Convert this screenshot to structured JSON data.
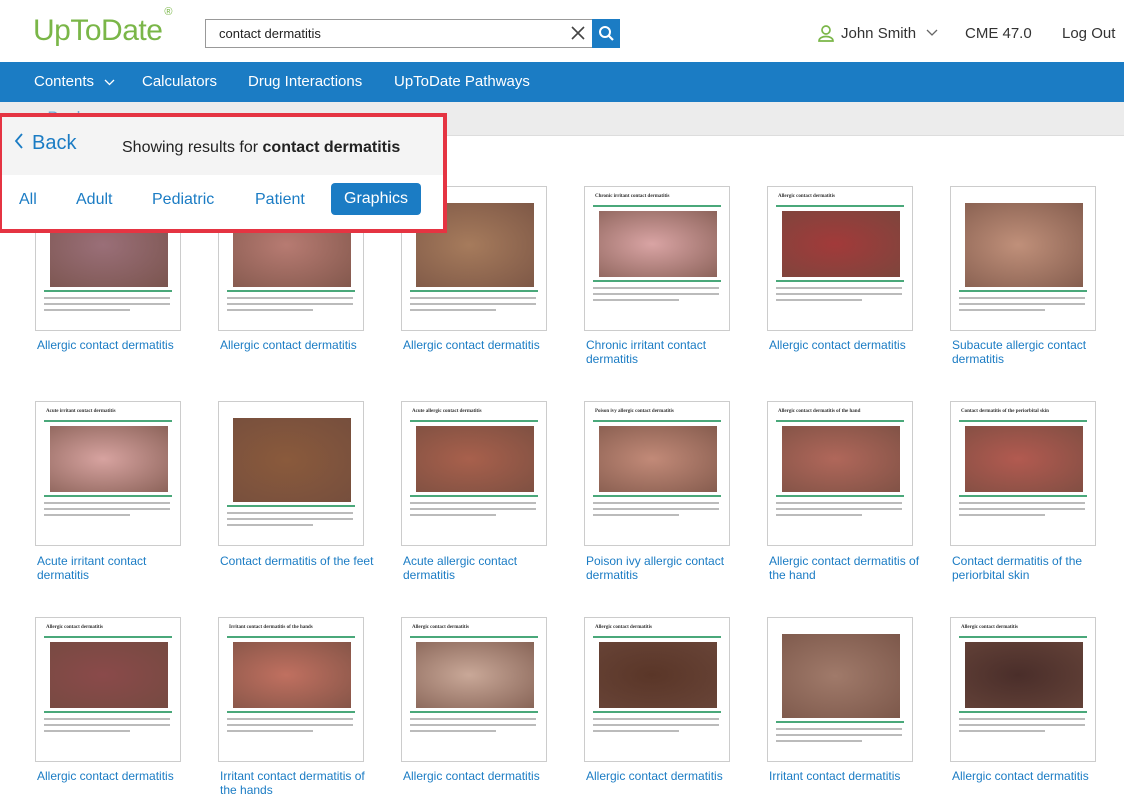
{
  "header": {
    "logo": "UpToDate",
    "logo_mark": "®",
    "search_value": "contact dermatitis",
    "user_name": "John Smith",
    "cme": "CME 47.0",
    "logout": "Log Out"
  },
  "nav": {
    "contents": "Contents",
    "calculators": "Calculators",
    "drug_interactions": "Drug Interactions",
    "pathways": "UpToDate Pathways"
  },
  "subbar": {
    "back": "‹ Back"
  },
  "results": {
    "back": "Back",
    "showing_prefix": "Showing results for ",
    "query": "contact dermatitis",
    "tabs": [
      "All",
      "Adult",
      "Pediatric",
      "Patient",
      "Graphics"
    ],
    "active_tab": "Graphics"
  },
  "cards": [
    {
      "caption": "Allergic contact dermatitis",
      "header": "",
      "photo_color": "#9a6f78"
    },
    {
      "caption": "Allergic contact dermatitis",
      "header": "",
      "photo_color": "#b77b72"
    },
    {
      "caption": "Allergic contact dermatitis",
      "header": "",
      "photo_color": "#a67b5c"
    },
    {
      "caption": "Chronic irritant contact dermatitis",
      "header": "Chronic irritant contact dermatitis",
      "photo_color": "#d9a4a4"
    },
    {
      "caption": "Allergic contact dermatitis",
      "header": "Allergic contact dermatitis",
      "photo_color": "#a23a3a"
    },
    {
      "caption": "Subacute allergic contact dermatitis",
      "header": "",
      "photo_color": "#c0907a"
    },
    {
      "caption": "Acute irritant contact dermatitis",
      "header": "Acute irritant contact dermatitis",
      "photo_color": "#d7a3a0"
    },
    {
      "caption": "Contact dermatitis of the feet",
      "header": "",
      "photo_color": "#8a5a3c"
    },
    {
      "caption": "Acute allergic contact dermatitis",
      "header": "Acute allergic contact dermatitis",
      "photo_color": "#a8604c"
    },
    {
      "caption": "Poison ivy allergic contact dermatitis",
      "header": "Poison ivy allergic contact dermatitis",
      "photo_color": "#c28a78"
    },
    {
      "caption": "Allergic contact dermatitis of the hand",
      "header": "Allergic contact dermatitis of the hand",
      "photo_color": "#b0675a"
    },
    {
      "caption": "Contact dermatitis of the periorbital skin",
      "header": "Contact dermatitis of the periorbital skin",
      "photo_color": "#b25a50"
    },
    {
      "caption": "Allergic contact dermatitis",
      "header": "Allergic contact dermatitis",
      "photo_color": "#8a4a4a"
    },
    {
      "caption": "Irritant contact dermatitis of the hands",
      "header": "Irritant contact dermatitis of the hands",
      "photo_color": "#c07060"
    },
    {
      "caption": "Allergic contact dermatitis",
      "header": "Allergic contact dermatitis",
      "photo_color": "#c9a898"
    },
    {
      "caption": "Allergic contact dermatitis",
      "header": "Allergic contact dermatitis",
      "photo_color": "#5a3628"
    },
    {
      "caption": "Irritant contact dermatitis",
      "header": "",
      "photo_color": "#a07a6a"
    },
    {
      "caption": "Allergic contact dermatitis",
      "header": "Allergic contact dermatitis",
      "photo_color": "#4a2e2a"
    }
  ]
}
